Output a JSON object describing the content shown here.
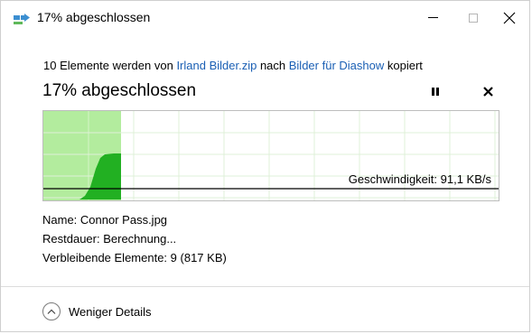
{
  "window": {
    "title": "17% abgeschlossen",
    "controls": {
      "minimize": "minimize",
      "maximize": "maximize",
      "close": "close"
    }
  },
  "copy": {
    "prefix": "10 Elemente werden von ",
    "source": "Irland Bilder.zip",
    "middle": " nach ",
    "destination": "Bilder für Diashow",
    "suffix": " kopiert"
  },
  "progress": {
    "label": "17% abgeschlossen",
    "percent": 17
  },
  "graph": {
    "speed_label": "Geschwindigkeit: 91,1 KB/s",
    "fill_color": "#b3ec9e",
    "curve_color": "#22b022",
    "line_color": "#000000"
  },
  "details": {
    "name_label": "Name:",
    "name_value": "Connor Pass.jpg",
    "remaining_time_label": "Restdauer:",
    "remaining_time_value": "Berechnung...",
    "remaining_items_label": "Verbleibende Elemente:",
    "remaining_items_value": "9 (817 KB)"
  },
  "footer": {
    "toggle_label": "Weniger Details"
  },
  "icons": {
    "title": "copy-progress-icon",
    "pause": "pause-icon",
    "cancel": "cancel-icon",
    "toggle": "chevron-up-icon"
  }
}
